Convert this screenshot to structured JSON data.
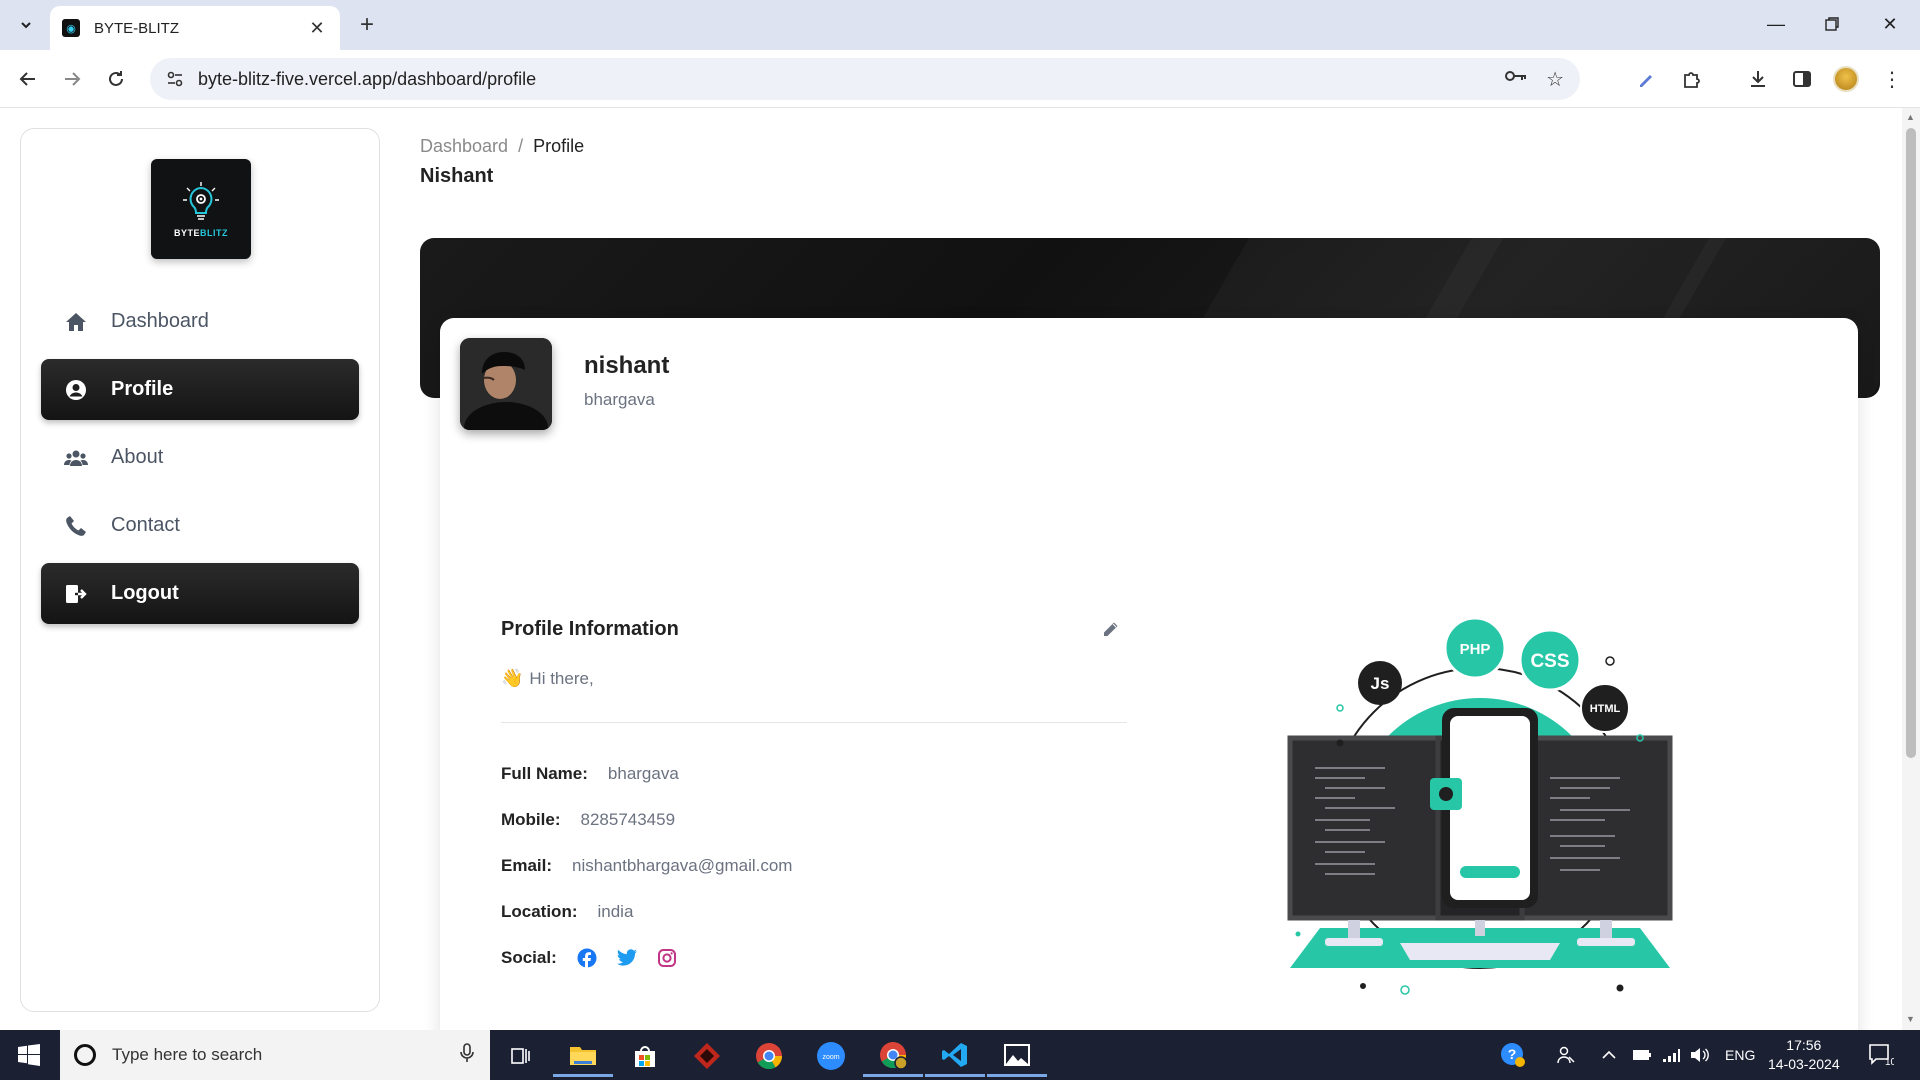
{
  "browser": {
    "tab_title": "BYTE-BLITZ",
    "url": "byte-blitz-five.vercel.app/dashboard/profile"
  },
  "logo": {
    "text_a": "BYTE",
    "text_b": "BLITZ"
  },
  "sidebar": {
    "items": [
      {
        "label": "Dashboard",
        "icon": "home-icon"
      },
      {
        "label": "Profile",
        "icon": "user-circle-icon"
      },
      {
        "label": "About",
        "icon": "users-icon"
      },
      {
        "label": "Contact",
        "icon": "phone-icon"
      },
      {
        "label": "Logout",
        "icon": "logout-icon"
      }
    ]
  },
  "breadcrumb": {
    "parent": "Dashboard",
    "separator": "/",
    "current": "Profile"
  },
  "page_title": "Nishant",
  "profile": {
    "name": "nishant",
    "subtitle": "bhargava"
  },
  "info": {
    "title": "Profile Information",
    "greeting": "Hi there,",
    "rows": [
      {
        "label": "Full Name:",
        "value": "bhargava"
      },
      {
        "label": "Mobile:",
        "value": "8285743459"
      },
      {
        "label": "Email:",
        "value": "nishantbhargava@gmail.com"
      },
      {
        "label": "Location:",
        "value": "india"
      },
      {
        "label": "Social:",
        "value": ""
      }
    ]
  },
  "illustration": {
    "badges": [
      "Js",
      "PHP",
      "CSS",
      "HTML"
    ]
  },
  "taskbar": {
    "search_placeholder": "Type here to search",
    "language": "ENG",
    "time": "17:56",
    "date": "14-03-2024",
    "notification_count": "10"
  },
  "colors": {
    "accent": "#26c6a6",
    "sidebar_active": "#1f1f1f",
    "taskbar": "#1b2033"
  }
}
